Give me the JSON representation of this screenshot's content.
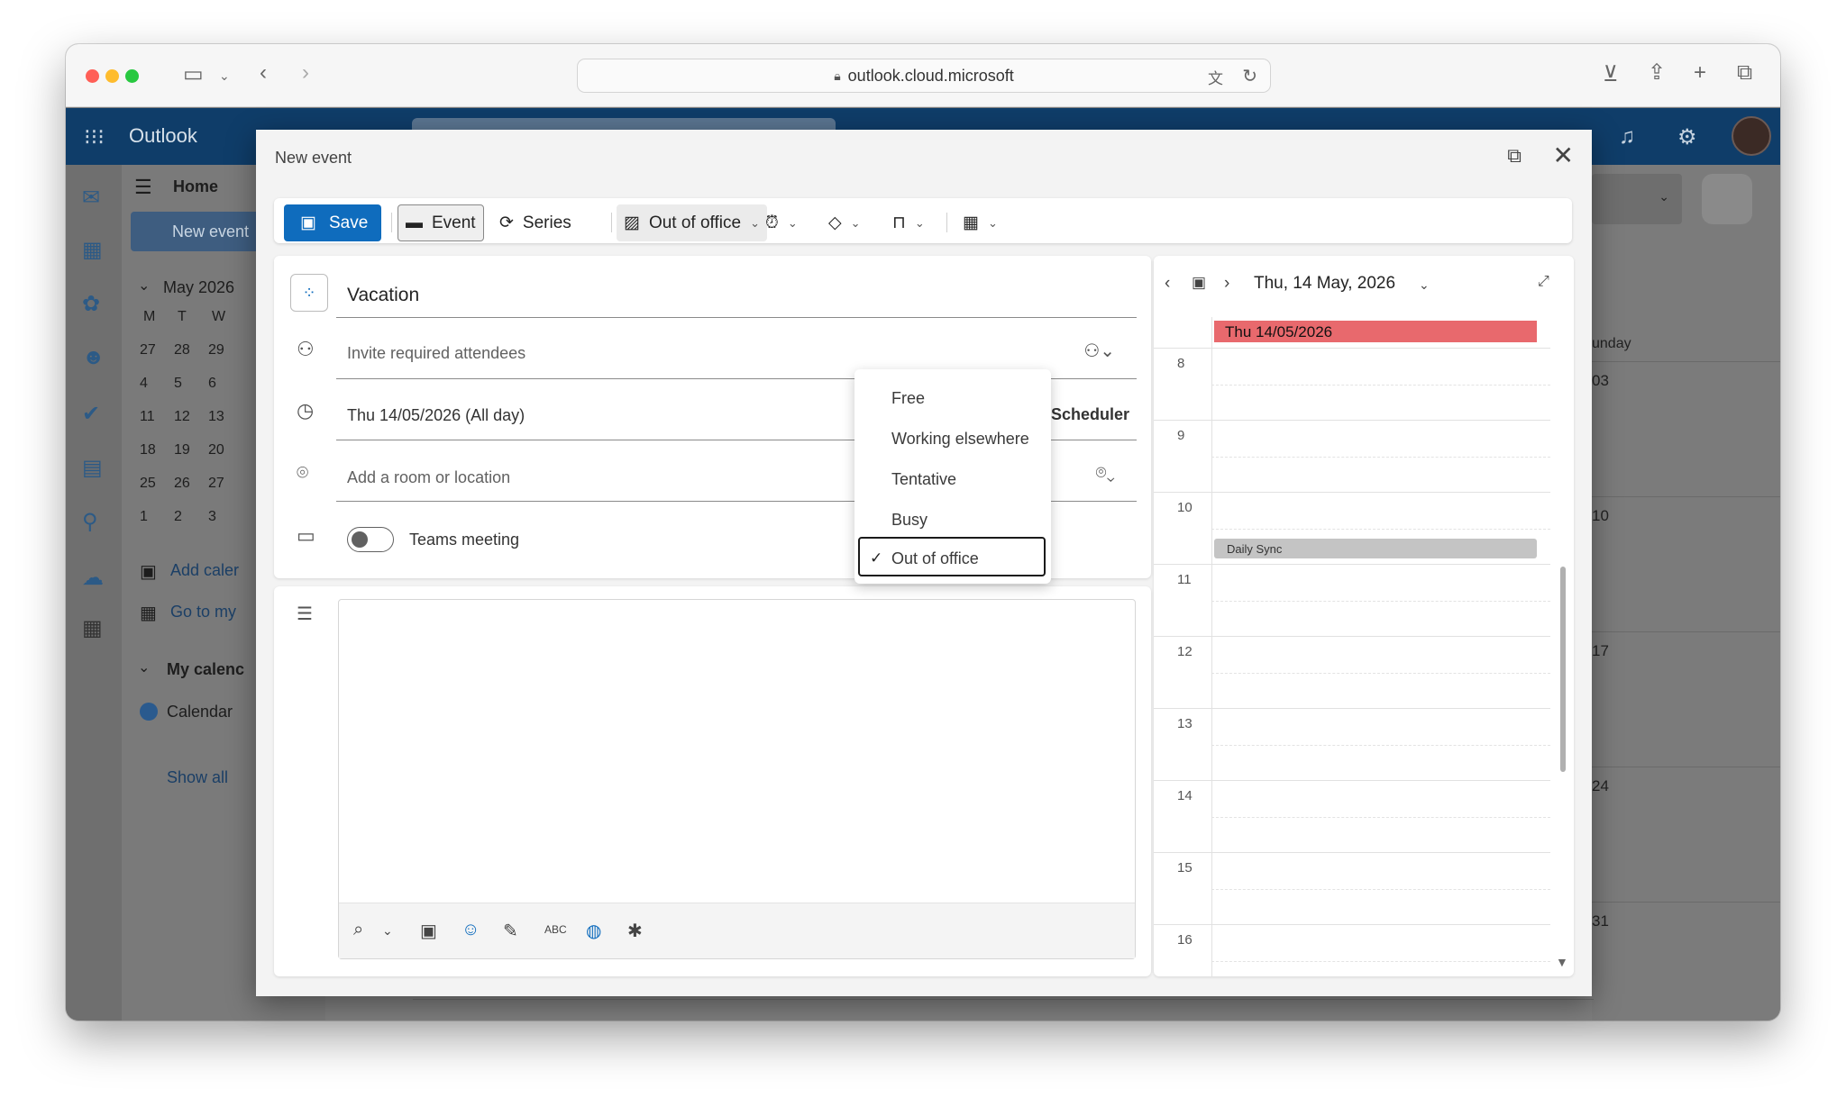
{
  "browser": {
    "url": "outlook.cloud.microsoft"
  },
  "app": {
    "name": "Outlook",
    "home_tab": "Home",
    "new_event_label": "New event",
    "month_label": "May 2026",
    "weekdays": [
      "M",
      "T",
      "W"
    ],
    "weeks": [
      [
        "27",
        "28",
        "29"
      ],
      [
        "4",
        "5",
        "6"
      ],
      [
        "11",
        "12",
        "13"
      ],
      [
        "18",
        "19",
        "20"
      ],
      [
        "25",
        "26",
        "27"
      ],
      [
        "1",
        "2",
        "3"
      ]
    ],
    "add_calendar": "Add caler",
    "go_to_my": "Go to my",
    "my_calendars": "My calenc",
    "calendar": "Calendar",
    "show_all": "Show all",
    "right_col": {
      "header": "unday",
      "dates": [
        "03",
        "10",
        "17",
        "24",
        "31"
      ]
    }
  },
  "modal": {
    "title": "New event",
    "toolbar": {
      "save": "Save",
      "event": "Event",
      "series": "Series",
      "show_as": "Out of office"
    },
    "form": {
      "title_value": "Vacation",
      "attendees_placeholder": "Invite required attendees",
      "date_value": "Thu 14/05/2026 (All day)",
      "scheduler": "Scheduler",
      "location_placeholder": "Add a room or location",
      "teams_label": "Teams meeting",
      "teams_on": false
    }
  },
  "show_as_menu": {
    "items": [
      "Free",
      "Working elsewhere",
      "Tentative",
      "Busy",
      "Out of office"
    ],
    "selected": "Out of office"
  },
  "day_view": {
    "date_title": "Thu, 14 May, 2026",
    "all_day_event": "Thu 14/05/2026",
    "hours": [
      "8",
      "9",
      "10",
      "11",
      "12",
      "13",
      "14",
      "15",
      "16"
    ],
    "events": [
      {
        "title": "Daily Sync"
      }
    ]
  },
  "colors": {
    "brand": "#0f6cbd",
    "out_of_office": "#e8696d",
    "header": "#0f3d69"
  },
  "icons": [
    "sidebar-icon",
    "back-icon",
    "forward-icon",
    "lock-icon",
    "translate-icon",
    "reload-icon",
    "download-icon",
    "share-icon",
    "plus-icon",
    "tabs-icon",
    "app-grid-icon",
    "bell-icon",
    "gear-icon",
    "popout-icon",
    "close-icon",
    "save-icon",
    "calendar-icon",
    "series-icon",
    "status-icon",
    "reminder-icon",
    "tag-icon",
    "privacy-icon",
    "apps-icon",
    "category-icon",
    "people-icon",
    "clock-icon",
    "location-icon",
    "video-icon",
    "notes-icon",
    "attach-icon",
    "image-icon",
    "sticker-icon",
    "draw-icon",
    "spellcheck-icon",
    "copilot-icon",
    "accessibility-icon",
    "expand-icon",
    "check-icon"
  ]
}
